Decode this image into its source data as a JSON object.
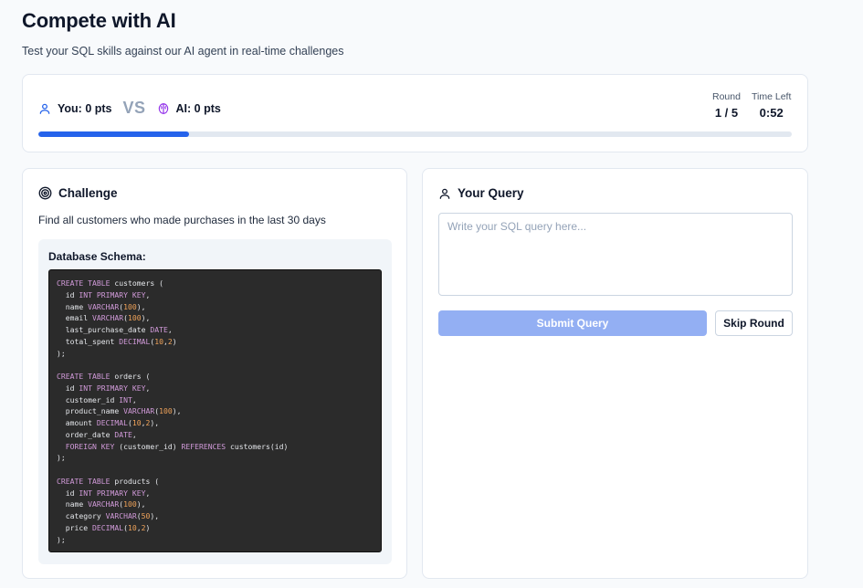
{
  "header": {
    "title": "Compete with AI",
    "subtitle": "Test your SQL skills against our AI agent in real-time challenges"
  },
  "scoreboard": {
    "you_label": "You: 0 pts",
    "vs_label": "VS",
    "ai_label": "AI: 0 pts",
    "round_label": "Round",
    "round_value": "1 / 5",
    "time_label": "Time Left",
    "time_value": "0:52",
    "progress_fraction": 0.2,
    "colors": {
      "progress": "#2563eb",
      "you_icon": "#2563eb",
      "ai_icon": "#9333ea"
    }
  },
  "challenge": {
    "heading": "Challenge",
    "icon": "target-icon",
    "description": "Find all customers who made purchases in the last 30 days",
    "schema_title": "Database Schema:",
    "schema_sql": "CREATE TABLE customers (\n  id INT PRIMARY KEY,\n  name VARCHAR(100),\n  email VARCHAR(100),\n  last_purchase_date DATE,\n  total_spent DECIMAL(10,2)\n);\n\nCREATE TABLE orders (\n  id INT PRIMARY KEY,\n  customer_id INT,\n  product_name VARCHAR(100),\n  amount DECIMAL(10,2),\n  order_date DATE,\n  FOREIGN KEY (customer_id) REFERENCES customers(id)\n);\n\nCREATE TABLE products (\n  id INT PRIMARY KEY,\n  name VARCHAR(100),\n  category VARCHAR(50),\n  price DECIMAL(10,2)\n);"
  },
  "query": {
    "heading": "Your Query",
    "icon": "user-icon",
    "placeholder": "Write your SQL query here...",
    "value": "",
    "submit_label": "Submit Query",
    "skip_label": "Skip Round"
  }
}
